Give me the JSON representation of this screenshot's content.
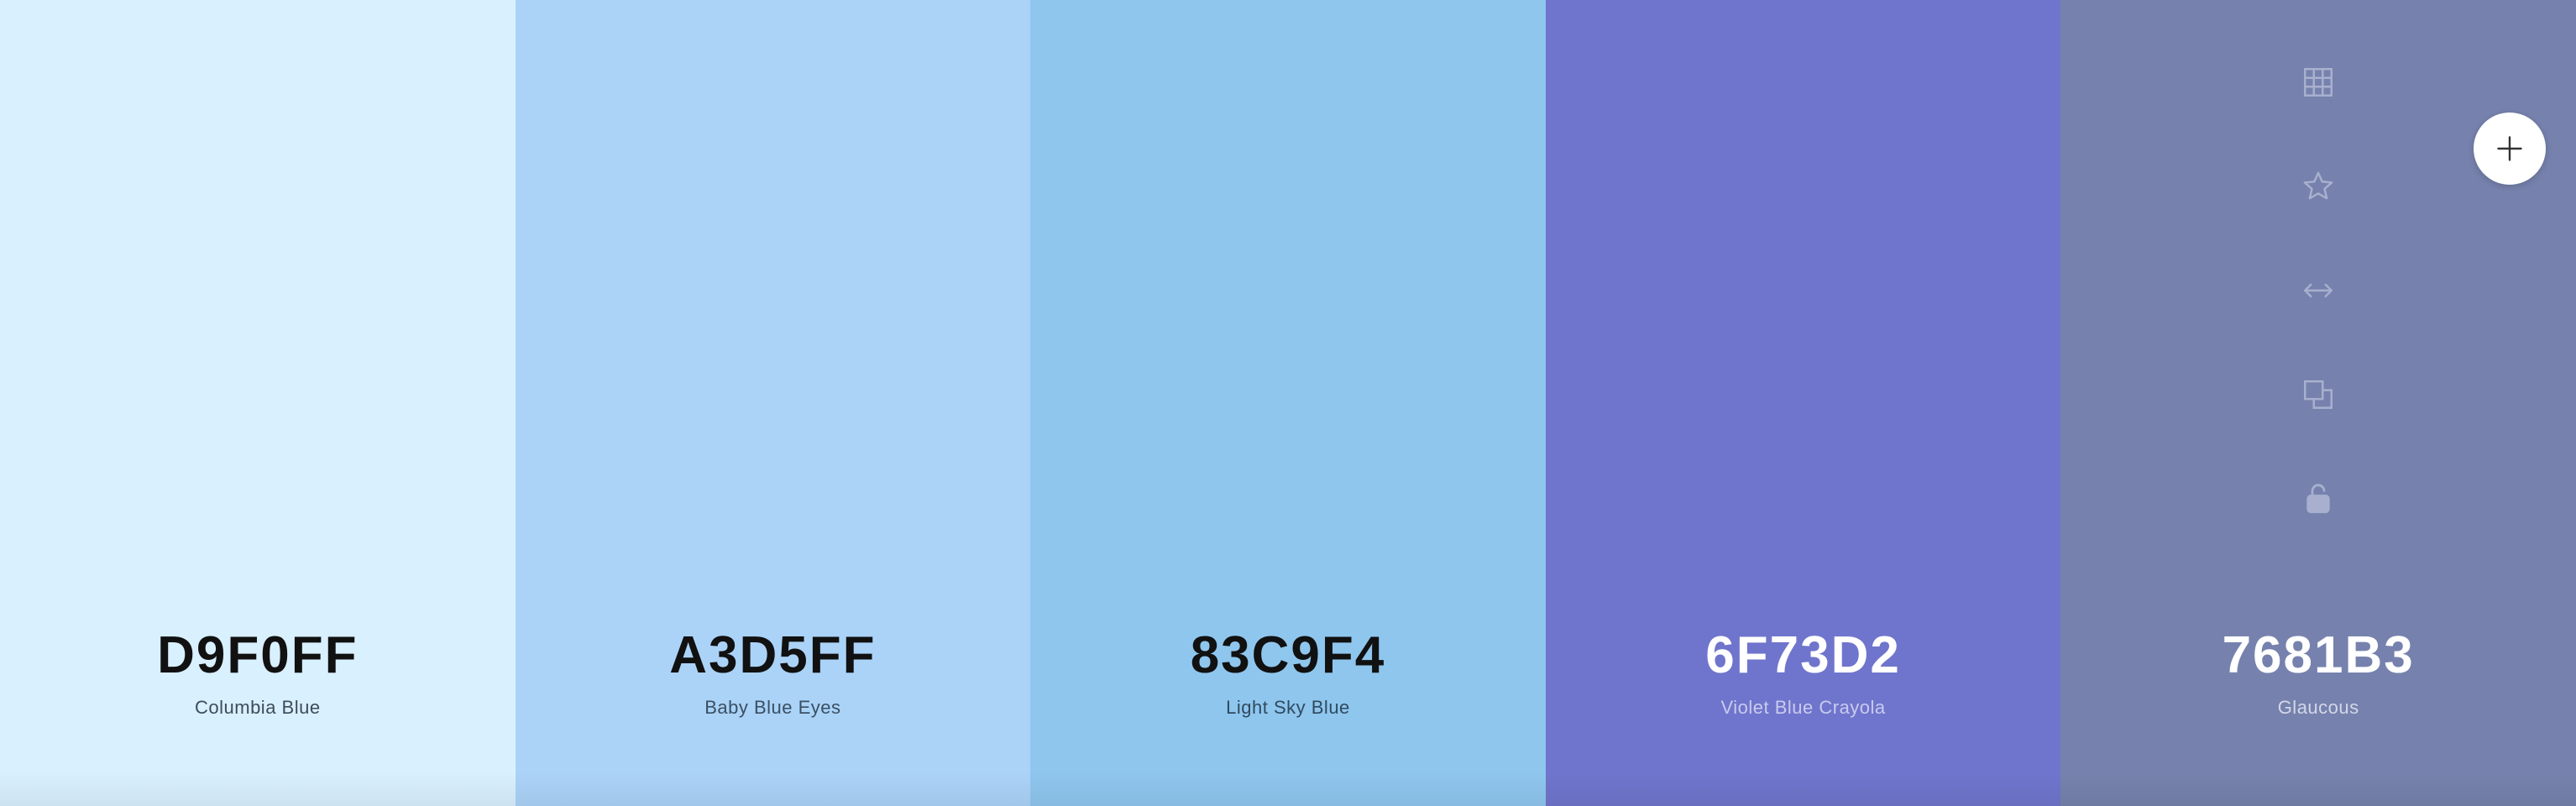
{
  "swatches": [
    {
      "hex": "D9F0FF",
      "name": "Columbia Blue",
      "color": "#D9F0FF",
      "hex_color": "#111111",
      "name_color": "#3d4c58"
    },
    {
      "hex": "A3D5FF",
      "name": "Baby Blue Eyes",
      "color": "#ABD3F8",
      "hex_color": "#111111",
      "name_color": "#3a4f63"
    },
    {
      "hex": "83C9F4",
      "name": "Light Sky Blue",
      "color": "#8FC6EE",
      "hex_color": "#111111",
      "name_color": "#2f4a5f"
    },
    {
      "hex": "6F73D2",
      "name": "Violet Blue Crayola",
      "color": "#6F75CC",
      "hex_color": "#ffffff",
      "name_color": "#c9cbee"
    },
    {
      "hex": "7681B3",
      "name": "Glaucous",
      "color": "#7682AD",
      "hex_color": "#ffffff",
      "name_color": "#d3d7e8"
    }
  ],
  "tools": [
    {
      "name": "grid-icon",
      "label": "View shades"
    },
    {
      "name": "star-icon",
      "label": "Save color"
    },
    {
      "name": "drag-arrows-icon",
      "label": "Drag"
    },
    {
      "name": "copy-icon",
      "label": "Copy hex"
    },
    {
      "name": "unlock-icon",
      "label": "Toggle lock"
    }
  ],
  "tool_icon_color": "#a9b0cf",
  "add_button": {
    "icon": "plus-icon"
  }
}
